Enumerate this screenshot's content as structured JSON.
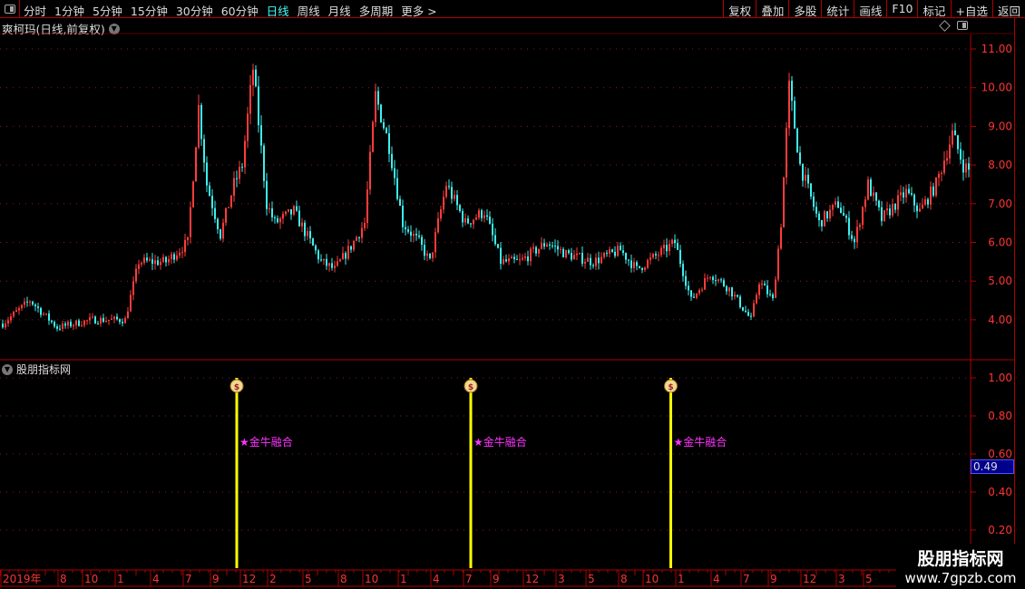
{
  "toolbar": {
    "periods": [
      "分时",
      "1分钟",
      "5分钟",
      "15分钟",
      "30分钟",
      "60分钟",
      "日线",
      "周线",
      "月线",
      "多周期",
      "更多 >"
    ],
    "active_period": "日线",
    "right_buttons": [
      "复权",
      "叠加",
      "多股",
      "统计",
      "画线",
      "F10",
      "标记",
      "+自选",
      "返回"
    ]
  },
  "main_title": "爽柯玛(日线,前复权)",
  "indicator_title": "股朋指标网",
  "indicator_value": "0.49",
  "signal_label": "★金牛融合",
  "watermark": {
    "line1": "股朋指标网",
    "line2": "www.7gpzb.com"
  },
  "colors": {
    "up": "#ff3c3c",
    "down": "#3cf0f0",
    "axis": "#ff3333",
    "frame": "#b00000",
    "signal": "#ffff00",
    "label": "#ff33ff"
  },
  "chart_data": [
    {
      "type": "candlestick",
      "title": "爽柯玛(日线,前复权)",
      "ylim": [
        3.2,
        11.6
      ],
      "yticks": [
        "11.00",
        "10.00",
        "9.00",
        "8.00",
        "7.00",
        "6.00",
        "5.00",
        "4.00"
      ],
      "ytick_values": [
        11,
        10,
        9,
        8,
        7,
        6,
        5,
        4
      ],
      "price_keypoints": [
        [
          0,
          3.9
        ],
        [
          10,
          4.5
        ],
        [
          20,
          3.8
        ],
        [
          33,
          4.0
        ],
        [
          45,
          4.0
        ],
        [
          50,
          5.5
        ],
        [
          60,
          5.5
        ],
        [
          68,
          6.0
        ],
        [
          72,
          9.5
        ],
        [
          75,
          7.5
        ],
        [
          80,
          6.2
        ],
        [
          85,
          7.5
        ],
        [
          88,
          8.0
        ],
        [
          92,
          10.5
        ],
        [
          97,
          7.0
        ],
        [
          100,
          6.5
        ],
        [
          107,
          6.8
        ],
        [
          117,
          5.5
        ],
        [
          122,
          5.3
        ],
        [
          128,
          5.9
        ],
        [
          133,
          6.5
        ],
        [
          137,
          9.8
        ],
        [
          142,
          8.5
        ],
        [
          147,
          6.5
        ],
        [
          153,
          6.0
        ],
        [
          157,
          5.5
        ],
        [
          163,
          7.5
        ],
        [
          170,
          6.5
        ],
        [
          177,
          6.8
        ],
        [
          183,
          5.5
        ],
        [
          190,
          5.5
        ],
        [
          200,
          6.0
        ],
        [
          207,
          5.7
        ],
        [
          217,
          5.5
        ],
        [
          227,
          5.8
        ],
        [
          233,
          5.3
        ],
        [
          247,
          6.0
        ],
        [
          253,
          4.5
        ],
        [
          260,
          5.2
        ],
        [
          267,
          4.8
        ],
        [
          275,
          4.0
        ],
        [
          278,
          5.0
        ],
        [
          283,
          4.5
        ],
        [
          286,
          6.5
        ],
        [
          289,
          10.0
        ],
        [
          293,
          8.0
        ],
        [
          300,
          6.5
        ],
        [
          307,
          7.0
        ],
        [
          313,
          6.0
        ],
        [
          318,
          7.5
        ],
        [
          323,
          6.6
        ],
        [
          332,
          7.3
        ],
        [
          337,
          6.8
        ],
        [
          343,
          7.5
        ],
        [
          349,
          8.8
        ],
        [
          353,
          8.0
        ],
        [
          356,
          7.8
        ]
      ]
    },
    {
      "type": "bar",
      "title": "股朋指标网",
      "ylim": [
        0,
        1.1
      ],
      "yticks": [
        "1.00",
        "0.80",
        "0.60",
        "0.40",
        "0.20"
      ],
      "ytick_values": [
        1.0,
        0.8,
        0.6,
        0.4,
        0.2
      ],
      "signals": [
        {
          "day": 86,
          "value": 1.0
        },
        {
          "day": 172,
          "value": 1.0
        },
        {
          "day": 245.5,
          "value": 1.0
        }
      ],
      "signal_label": "★金牛融合",
      "current_value": 0.49
    }
  ],
  "x_axis": {
    "labels": [
      "2019年",
      "8",
      "10",
      "1",
      "4",
      "7",
      "9",
      "12",
      "2",
      "5",
      "8",
      "10",
      "1",
      "4",
      "7",
      "9",
      "12",
      "3",
      "5",
      "8",
      "10",
      "1",
      "4",
      "7",
      "9",
      "12",
      "3",
      "5"
    ],
    "label_days": [
      0,
      21,
      30,
      42,
      55,
      67,
      77,
      88,
      98,
      111,
      124,
      133,
      146,
      158,
      170,
      180,
      192,
      204,
      215,
      227,
      236,
      248,
      261,
      272,
      282,
      294,
      307,
      317
    ]
  }
}
